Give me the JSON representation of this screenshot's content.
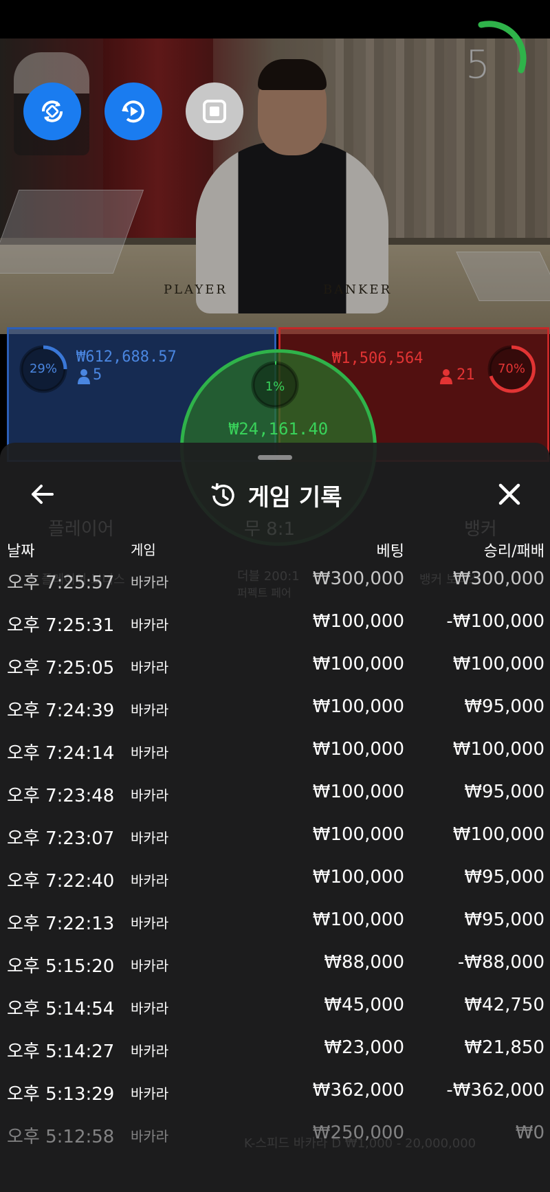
{
  "timer": {
    "value": "5"
  },
  "controls": [
    {
      "name": "rotate-icon"
    },
    {
      "name": "replay-icon"
    },
    {
      "name": "stop-icon"
    }
  ],
  "table": {
    "player_text": "PLAYER",
    "banker_text": "BANKER"
  },
  "bets": {
    "player": {
      "percent": "29%",
      "amount": "₩612,688.57",
      "players": "5",
      "color": "#3a78d8"
    },
    "banker": {
      "percent": "70%",
      "amount": "₩1,506,564",
      "players": "21",
      "color": "#e23434"
    },
    "tie": {
      "percent": "1%",
      "amount": "₩24,161.40",
      "color": "#39d25a"
    }
  },
  "history": {
    "title": "게임 기록",
    "columns": {
      "date": "날짜",
      "game": "게임",
      "bet": "베팅",
      "result": "승리/패배"
    },
    "rows": [
      {
        "date": "오후 7:25:57",
        "game": "바카라",
        "bet": "₩300,000",
        "result": "₩300,000"
      },
      {
        "date": "오후 7:25:31",
        "game": "바카라",
        "bet": "₩100,000",
        "result": "-₩100,000"
      },
      {
        "date": "오후 7:25:05",
        "game": "바카라",
        "bet": "₩100,000",
        "result": "₩100,000"
      },
      {
        "date": "오후 7:24:39",
        "game": "바카라",
        "bet": "₩100,000",
        "result": "₩95,000"
      },
      {
        "date": "오후 7:24:14",
        "game": "바카라",
        "bet": "₩100,000",
        "result": "₩100,000"
      },
      {
        "date": "오후 7:23:48",
        "game": "바카라",
        "bet": "₩100,000",
        "result": "₩95,000"
      },
      {
        "date": "오후 7:23:07",
        "game": "바카라",
        "bet": "₩100,000",
        "result": "₩100,000"
      },
      {
        "date": "오후 7:22:40",
        "game": "바카라",
        "bet": "₩100,000",
        "result": "₩95,000"
      },
      {
        "date": "오후 7:22:13",
        "game": "바카라",
        "bet": "₩100,000",
        "result": "₩95,000"
      },
      {
        "date": "오후 5:15:20",
        "game": "바카라",
        "bet": "₩88,000",
        "result": "-₩88,000"
      },
      {
        "date": "오후 5:14:54",
        "game": "바카라",
        "bet": "₩45,000",
        "result": "₩42,750"
      },
      {
        "date": "오후 5:14:27",
        "game": "바카라",
        "bet": "₩23,000",
        "result": "₩21,850"
      },
      {
        "date": "오후 5:13:29",
        "game": "바카라",
        "bet": "₩362,000",
        "result": "-₩362,000"
      },
      {
        "date": "오후 5:12:58",
        "game": "바카라",
        "bet": "₩250,000",
        "result": "₩0"
      }
    ]
  },
  "background_ghost": {
    "player_label": "플레이어",
    "tie_label": "무 8:1",
    "banker_label": "뱅커",
    "player_bonus": "플레이어 보너스",
    "banker_bonus": "뱅커 보너스",
    "double_label": "더블 200:1",
    "perfect_pair": "퍼펙트 페어",
    "limits": "K-스피드 바카라 D ₩1,000 - 20,000,000"
  }
}
